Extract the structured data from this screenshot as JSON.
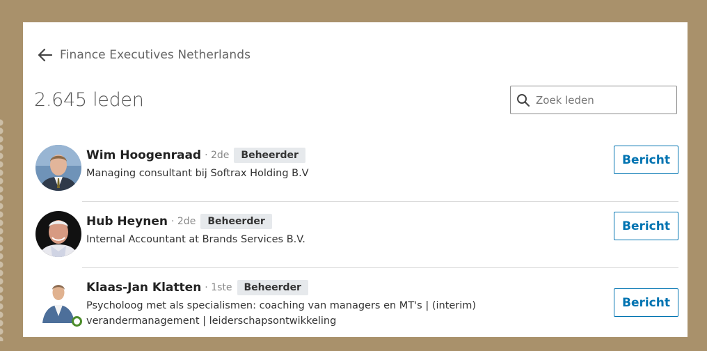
{
  "group": {
    "title": "Finance Executives Netherlands",
    "member_count": "2.645 leden"
  },
  "search": {
    "placeholder": "Zoek leden"
  },
  "members": [
    {
      "name": "Wim Hoogenraad",
      "degree": "· 2de",
      "badge": "Beheerder",
      "headline": "Managing consultant bij Softrax Holding B.V",
      "button": "Bericht"
    },
    {
      "name": "Hub Heynen",
      "degree": "· 2de",
      "badge": "Beheerder",
      "headline": "Internal Accountant at Brands Services B.V.",
      "button": "Bericht"
    },
    {
      "name": "Klaas-Jan Klatten",
      "degree": "· 1ste",
      "badge": "Beheerder",
      "headline": "Psycholoog met als specialismen: coaching van managers en MT's | (interim)",
      "headline_line2": "verandermanagement | leiderschapsontwikkeling",
      "button": "Bericht",
      "online": true
    }
  ],
  "colors": {
    "frame": "#a9916b",
    "accent": "#0073b1",
    "online": "#4c8c2a"
  },
  "icons": {
    "back": "arrow-left-icon",
    "search": "search-icon"
  }
}
